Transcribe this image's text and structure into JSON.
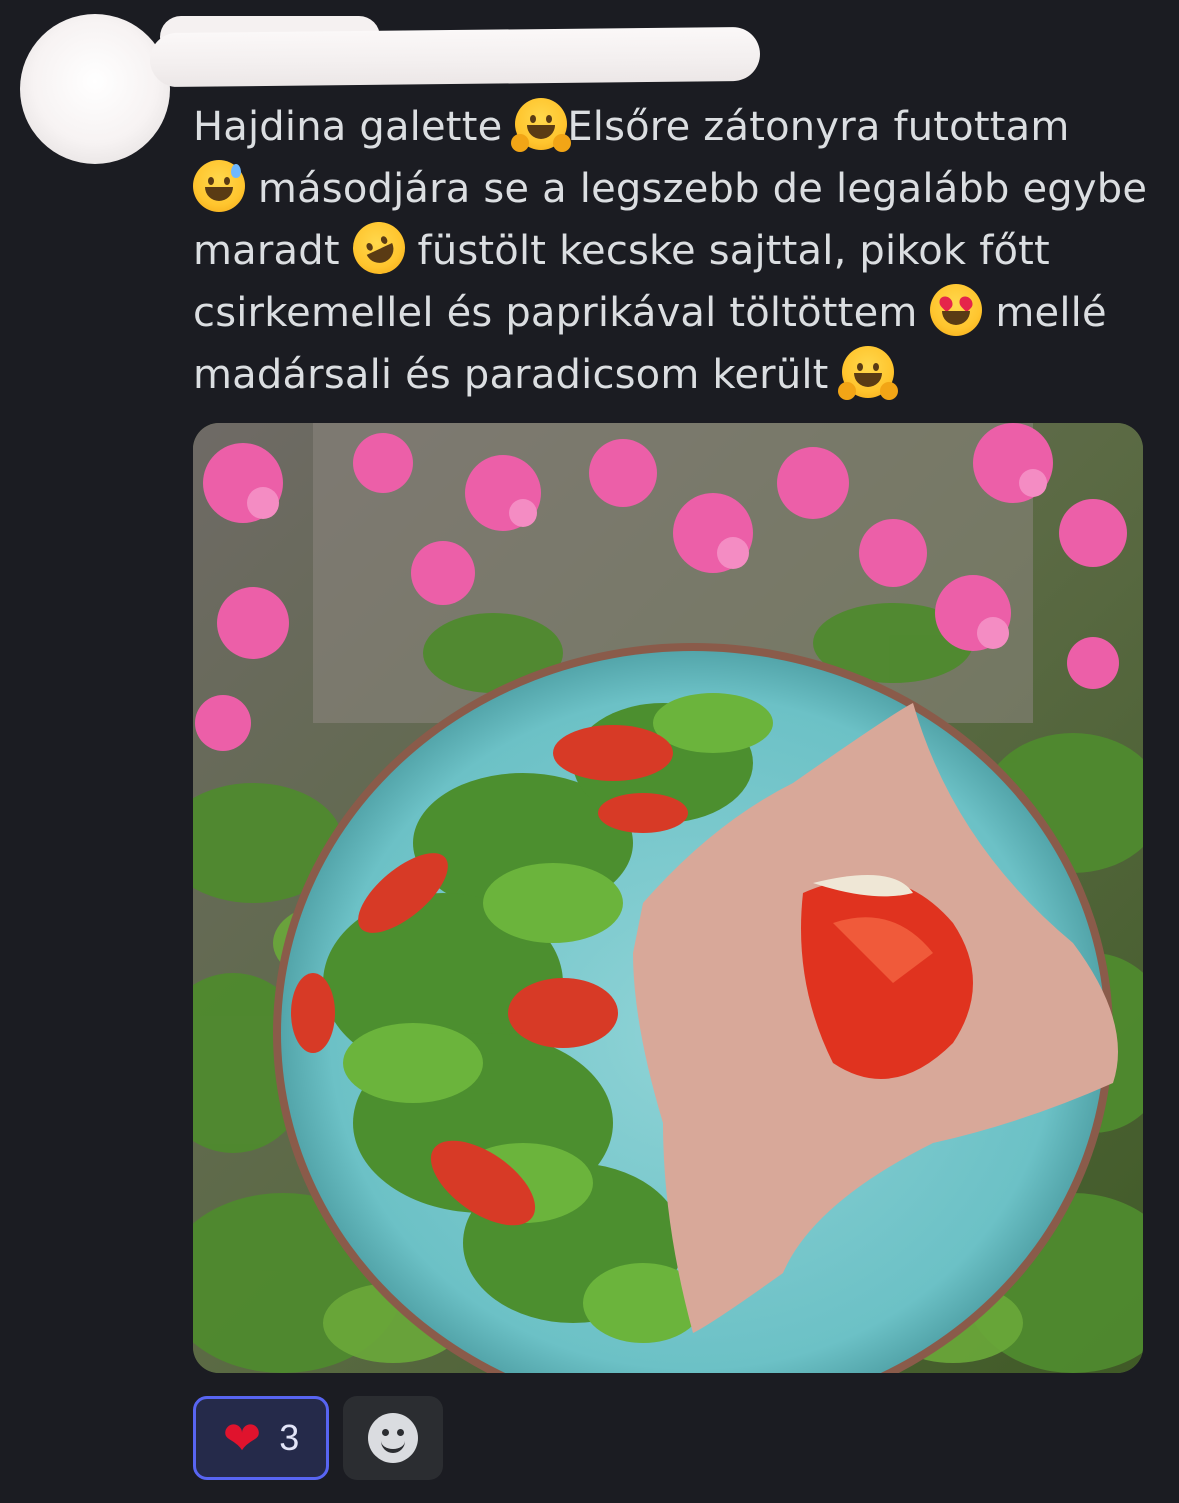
{
  "message": {
    "author": "",
    "timestamp": "",
    "line1_a": "Hajdina galette ",
    "line1_b": "Elsőre zátonyra futottam",
    "line2": " másodjára se a legszebb de legalább egybe",
    "line3_a": "maradt ",
    "line3_b": "  füstölt kecske sajttal, pikok főtt",
    "line4_a": "csirkemellel és paprikával töltöttem ",
    "line4_b": " mellé",
    "line5": "madársali és paradicsom került ",
    "emojis": [
      "hugging-face",
      "grinning-sweat",
      "rolling-on-floor-laughing",
      "heart-eyes",
      "hugging-face"
    ]
  },
  "attachment": {
    "kind": "photo"
  },
  "reactions": [
    {
      "emoji": "red-heart",
      "glyph": "❤",
      "count": "3",
      "selected": true,
      "color": "#e0132d"
    }
  ],
  "colors": {
    "background": "#1b1c22",
    "text": "#dbdee1",
    "accent": "#5865f2"
  }
}
